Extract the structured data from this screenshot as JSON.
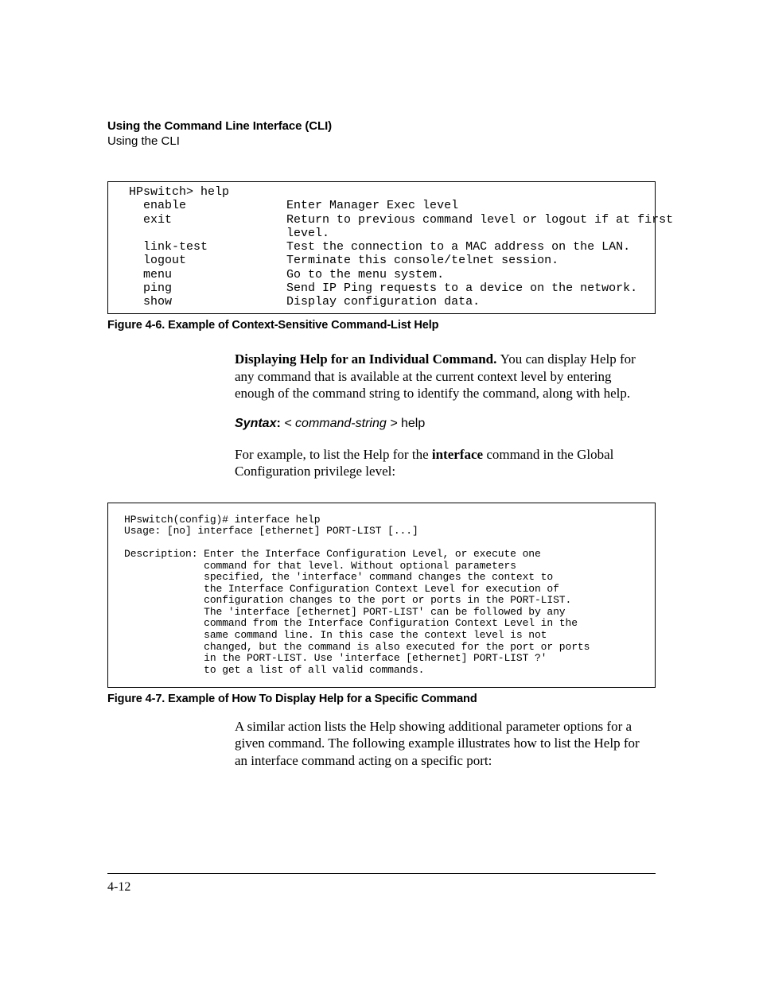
{
  "header": {
    "title": "Using the Command Line Interface (CLI)",
    "subtitle": "Using the CLI"
  },
  "box1": {
    "prompt": "HPswitch> help",
    "rows": [
      {
        "cmd": "enable",
        "desc": "Enter Manager Exec level"
      },
      {
        "cmd": "exit",
        "desc": "Return to previous command level or logout if at first"
      },
      {
        "cmd": "",
        "desc": "level."
      },
      {
        "cmd": "link-test",
        "desc": "Test the connection to a MAC address on the LAN."
      },
      {
        "cmd": "logout",
        "desc": "Terminate this console/telnet session."
      },
      {
        "cmd": "menu",
        "desc": "Go to the menu system."
      },
      {
        "cmd": "ping",
        "desc": "Send IP Ping requests to a device on the network."
      },
      {
        "cmd": "show",
        "desc": "Display configuration data."
      }
    ]
  },
  "caption1": "Figure 4-6.   Example of Context-Sensitive Command-List Help",
  "para1": {
    "runin": "Displaying Help for an Individual Command.  ",
    "rest": "You can display Help for any command that is available at the current context level by entering enough of the command string to identify the command, along with help."
  },
  "syntax": {
    "label": "Syntax",
    "colon": ":  ",
    "arg": "< command-string >",
    "help": " help"
  },
  "para2": {
    "pre": "For example, to list  the Help for the ",
    "kw": "interface",
    "post": " command in the Global Configuration privilege level:"
  },
  "box2": {
    "line1": "HPswitch(config)# interface help",
    "line2": "Usage: [no] interface [ethernet] PORT-LIST [...]",
    "descLabel": "Description: ",
    "descLines": [
      "Enter the Interface Configuration Level, or execute one",
      "command for that level. Without optional parameters",
      "specified, the 'interface' command changes the context to",
      "the Interface Configuration Context Level for execution of",
      "configuration changes to the port or ports in the PORT-LIST.",
      "The 'interface [ethernet] PORT-LIST' can be followed by any",
      "command from the Interface Configuration Context Level in the",
      "same command line. In this case the context level is not",
      "changed, but the command is also executed for the port or ports",
      "in the PORT-LIST. Use 'interface [ethernet] PORT-LIST ?'",
      "to get a list of all valid commands."
    ]
  },
  "caption2": "Figure 4-7.   Example of How To Display Help for a Specific Command",
  "para3": "A similar action lists the Help showing additional parameter options for a given command. The following example illustrates how to list the Help for an interface command acting on a specific port:",
  "pageNum": "4-12"
}
